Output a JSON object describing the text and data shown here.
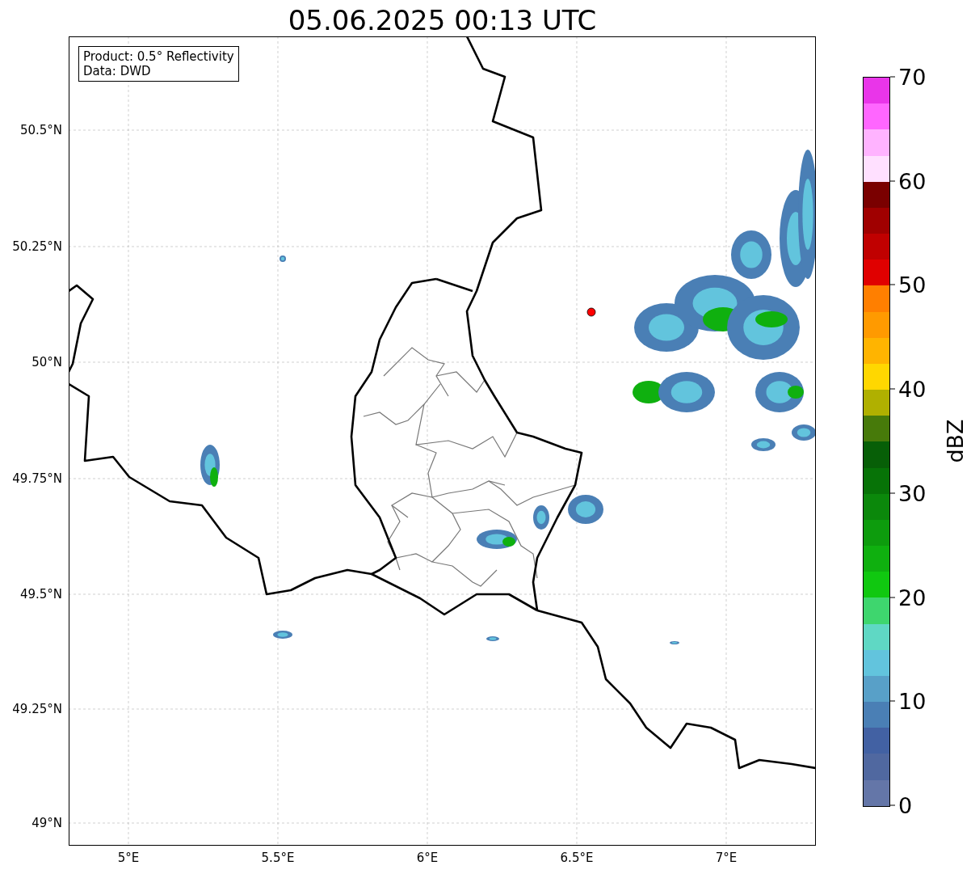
{
  "title": "05.06.2025 00:13 UTC",
  "info_box": [
    "Product: 0.5° Reflectivity",
    "Data: DWD"
  ],
  "map": {
    "lat_labels": [
      "50.5°N",
      "50.25°N",
      "50°N",
      "49.75°N",
      "49.5°N",
      "49.25°N",
      "49°N"
    ],
    "lon_labels": [
      "5°E",
      "5.5°E",
      "6°E",
      "6.5°E",
      "7°E"
    ]
  },
  "colorbar": {
    "label": "dBZ",
    "ticks": [
      "70",
      "60",
      "50",
      "40",
      "30",
      "20",
      "10",
      "0"
    ],
    "segments": [
      {
        "color": "#e935e9"
      },
      {
        "color": "#ff66ff"
      },
      {
        "color": "#ffb3ff"
      },
      {
        "color": "#ffe0ff"
      },
      {
        "color": "#7a0000"
      },
      {
        "color": "#a00000"
      },
      {
        "color": "#c00000"
      },
      {
        "color": "#e00000"
      },
      {
        "color": "#ff7f00"
      },
      {
        "color": "#ff9a00"
      },
      {
        "color": "#ffb400"
      },
      {
        "color": "#ffd700"
      },
      {
        "color": "#b0b000"
      },
      {
        "color": "#477a0a"
      },
      {
        "color": "#075f07"
      },
      {
        "color": "#077307"
      },
      {
        "color": "#0b880b"
      },
      {
        "color": "#0d9c0d"
      },
      {
        "color": "#0fb00f"
      },
      {
        "color": "#10c810"
      },
      {
        "color": "#3ed66e"
      },
      {
        "color": "#5fd8c4"
      },
      {
        "color": "#62c4dd"
      },
      {
        "color": "#58a0c8"
      },
      {
        "color": "#4a7fb5"
      },
      {
        "color": "#4261a3"
      },
      {
        "color": "#5068a0"
      },
      {
        "color": "#6476a8"
      }
    ]
  }
}
